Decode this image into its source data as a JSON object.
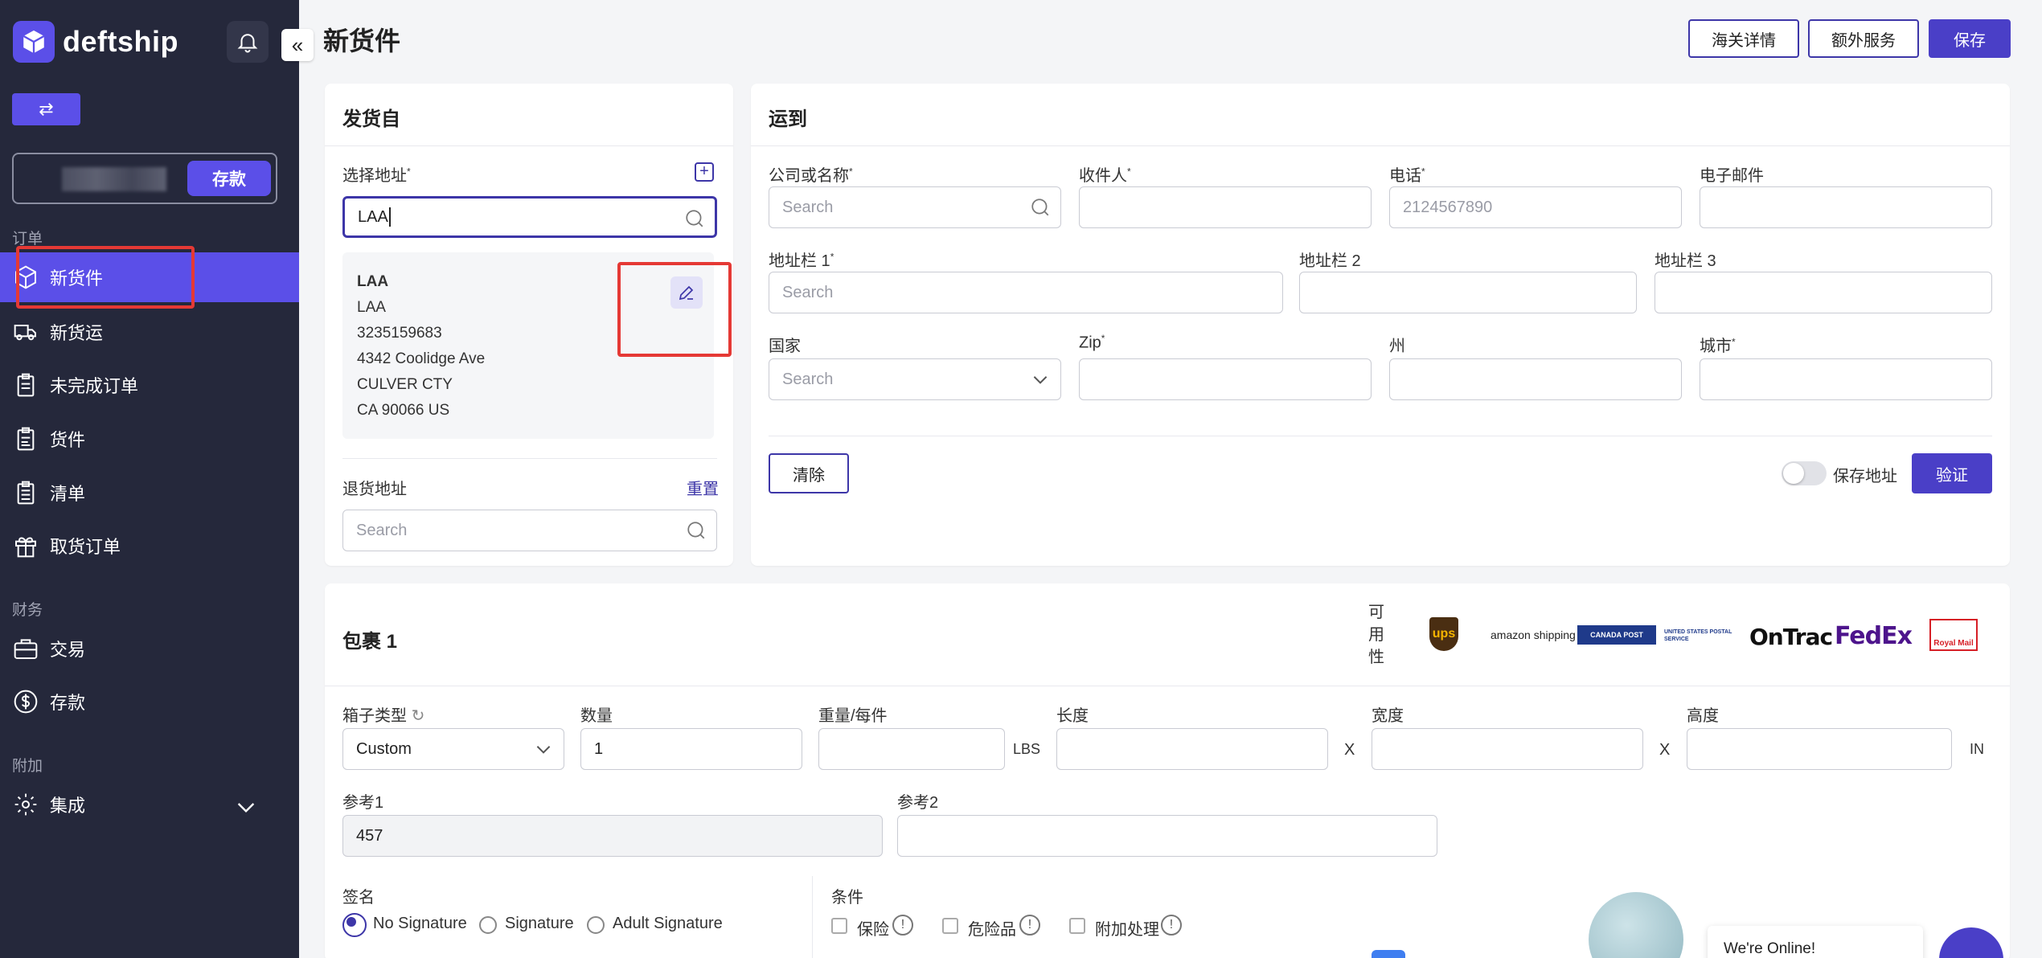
{
  "brand": {
    "name": "deftship",
    "accent": "#5b4fe8",
    "sidebar_bg": "#25283b"
  },
  "sidebar": {
    "deposit_label": "存款",
    "sections": {
      "orders": "订单",
      "finance": "财务",
      "extra": "附加"
    },
    "items": [
      {
        "label": "新货件",
        "icon": "box-icon",
        "active": true
      },
      {
        "label": "新货运",
        "icon": "truck-icon"
      },
      {
        "label": "未完成订单",
        "icon": "clipboard-icon"
      },
      {
        "label": "货件",
        "icon": "clipboard-check-icon"
      },
      {
        "label": "清单",
        "icon": "list-icon"
      },
      {
        "label": "取货订单",
        "icon": "gift-icon"
      },
      {
        "label": "交易",
        "icon": "briefcase-icon"
      },
      {
        "label": "存款",
        "icon": "dollar-icon"
      },
      {
        "label": "集成",
        "icon": "gear-icon"
      }
    ]
  },
  "header": {
    "title": "新货件",
    "customs_label": "海关详情",
    "extra_services_label": "额外服务",
    "save_label": "保存"
  },
  "ship_from": {
    "title": "发货自",
    "select_address_label": "选择地址",
    "search_value": "LAA",
    "address": [
      "LAA",
      "LAA",
      "3235159683",
      "4342 Coolidge Ave",
      "CULVER CTY",
      "CA 90066 US"
    ],
    "return_label": "退货地址",
    "reset_label": "重置",
    "return_placeholder": "Search"
  },
  "ship_to": {
    "title": "运到",
    "company_label": "公司或名称",
    "company_placeholder": "Search",
    "recipient_label": "收件人",
    "phone_label": "电话",
    "phone_placeholder": "2124567890",
    "email_label": "电子邮件",
    "addr1_label": "地址栏 1",
    "addr1_placeholder": "Search",
    "addr2_label": "地址栏 2",
    "addr3_label": "地址栏 3",
    "country_label": "国家",
    "country_placeholder": "Search",
    "zip_label": "Zip",
    "state_label": "州",
    "city_label": "城市",
    "clear_label": "清除",
    "save_address_label": "保存地址",
    "verify_label": "验证"
  },
  "package": {
    "title": "包裹 1",
    "availability_label": "可用性",
    "carriers": [
      "ups",
      "amazon shipping",
      "CANADA POST",
      "UNITED STATES POSTAL SERVICE",
      "OnTrac",
      "FedEx",
      "Royal Mail"
    ],
    "box_type_label": "箱子类型",
    "box_type_value": "Custom",
    "quantity_label": "数量",
    "quantity_value": "1",
    "weight_label": "重量/每件",
    "weight_unit": "LBS",
    "length_label": "长度",
    "width_label": "宽度",
    "height_label": "高度",
    "dim_separator": "X",
    "dim_unit": "IN",
    "ref1_label": "参考1",
    "ref1_value": "457",
    "ref2_label": "参考2",
    "signature_label": "签名",
    "signature_options": [
      "No Signature",
      "Signature",
      "Adult Signature"
    ],
    "conditions_label": "条件",
    "conditions": [
      "保险",
      "危险品",
      "附加处理"
    ]
  },
  "chat": {
    "online_text": "We're Online!"
  }
}
